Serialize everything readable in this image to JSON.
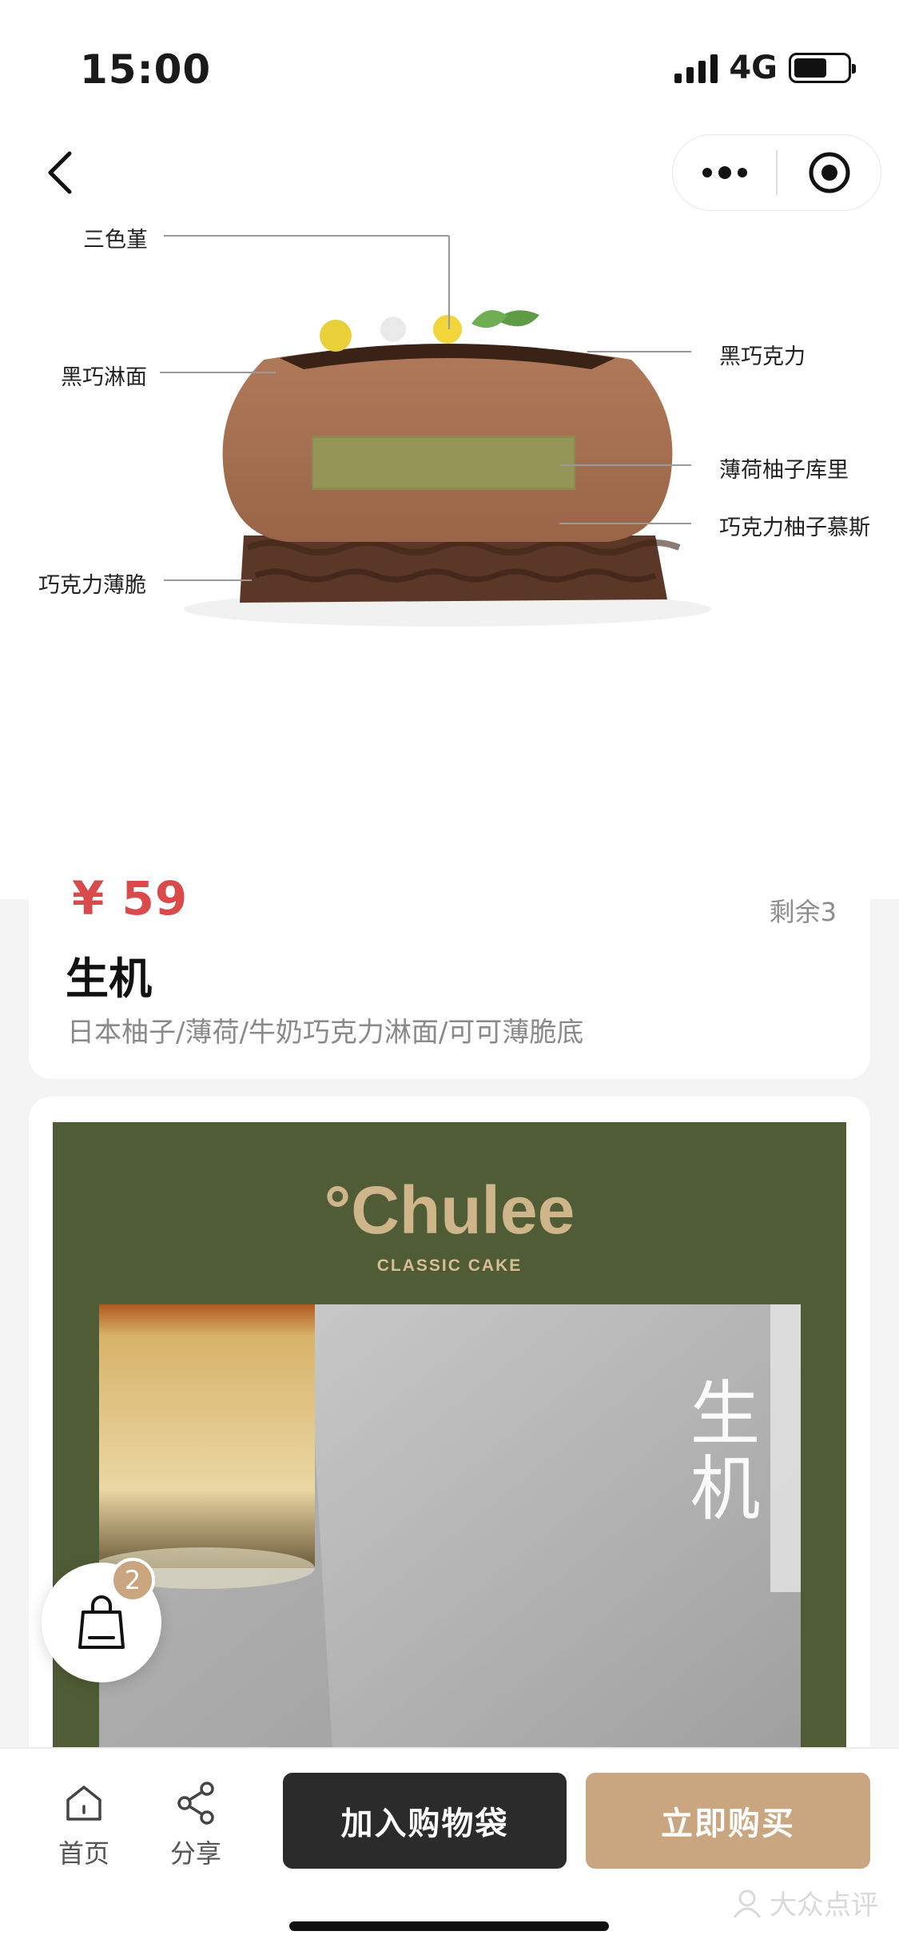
{
  "status_bar": {
    "time": "15:00",
    "network": "4G"
  },
  "nav": {
    "back_icon": "chevron-left-icon",
    "more_icon": "more-dots-icon",
    "target_icon": "target-icon"
  },
  "hero": {
    "callouts": [
      {
        "label": "三色堇"
      },
      {
        "label": "黑巧淋面"
      },
      {
        "label": "巧克力薄脆"
      },
      {
        "label": "黑巧克力"
      },
      {
        "label": "薄荷柚子库里"
      },
      {
        "label": "巧克力柚子慕斯"
      }
    ]
  },
  "product": {
    "price": "¥ 59",
    "stock": "剩余3",
    "name": "生机",
    "description": "日本柚子/薄荷/牛奶巧克力淋面/可可薄脆底"
  },
  "poster": {
    "brand": "°Chulee",
    "subtitle": "CLASSIC CAKE",
    "vertical_text": "生机"
  },
  "cart_fab": {
    "icon": "shopping-bag-icon",
    "count": "2"
  },
  "bottom_bar": {
    "home_label": "首页",
    "share_label": "分享",
    "add_to_bag_label": "加入购物袋",
    "buy_now_label": "立即购买",
    "watermark": "大众点评"
  }
}
